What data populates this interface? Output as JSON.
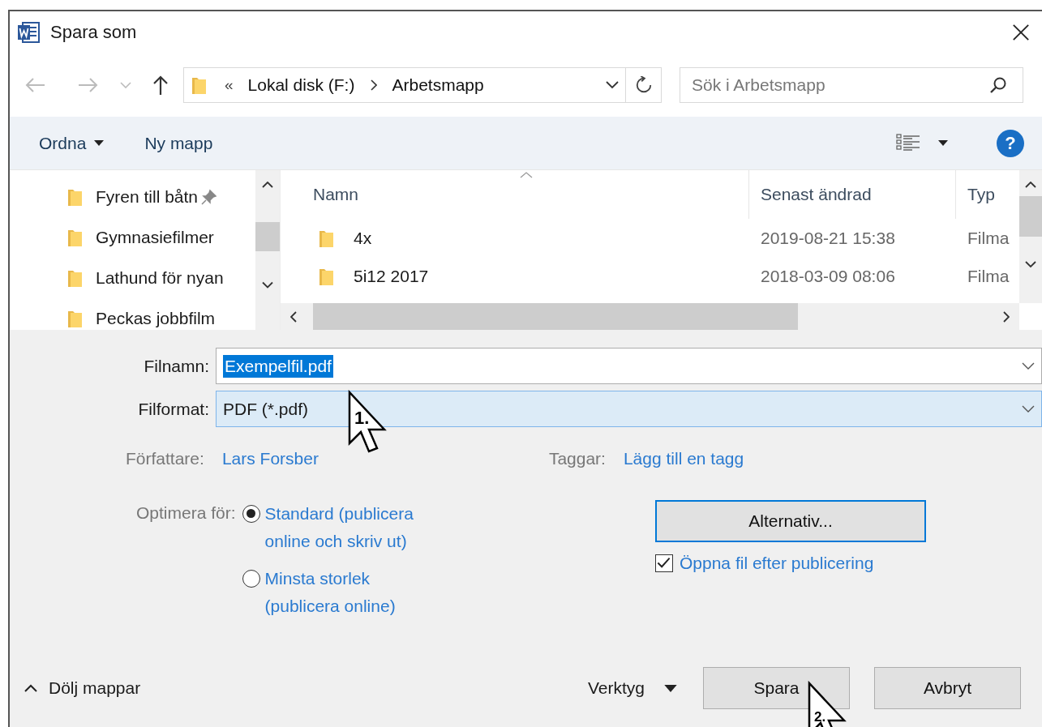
{
  "window": {
    "title": "Spara som"
  },
  "address": {
    "overflow_mark": "«",
    "path": [
      "Lokal disk (F:)",
      "Arbetsmapp"
    ]
  },
  "search": {
    "placeholder": "Sök i Arbetsmapp"
  },
  "toolbar": {
    "organize": "Ordna",
    "new_folder": "Ny mapp",
    "help": "?"
  },
  "sidebar": {
    "items": [
      {
        "label": "Fyren till båtn",
        "pinned": true
      },
      {
        "label": "Gymnasiefilmer",
        "pinned": false
      },
      {
        "label": "Lathund för nyan",
        "pinned": false
      },
      {
        "label": "Peckas jobbfilm",
        "pinned": false
      }
    ]
  },
  "table": {
    "columns": [
      "Namn",
      "Senast ändrad",
      "Typ"
    ],
    "rows": [
      {
        "name": "4x",
        "modified": "2019-08-21 15:38",
        "type": "Filma"
      },
      {
        "name": "5i12 2017",
        "modified": "2018-03-09 08:06",
        "type": "Filma"
      }
    ]
  },
  "form": {
    "filename": {
      "label": "Filnamn:",
      "value": "Exempelfil.pdf",
      "text_selected": true
    },
    "format": {
      "label": "Filformat:",
      "value": "PDF (*.pdf)",
      "focused": true
    },
    "author": {
      "label": "Författare:",
      "value": "Lars Forsber"
    },
    "tags": {
      "label": "Taggar:",
      "value": "Lägg till en tagg"
    }
  },
  "optimize": {
    "label": "Optimera för:",
    "options": [
      {
        "label": "Standard (publicera online och skriv ut)",
        "selected": true
      },
      {
        "label": "Minsta storlek (publicera online)",
        "selected": false
      }
    ]
  },
  "options_button": "Alternativ...",
  "open_after": {
    "label": "Öppna fil efter publicering",
    "checked": true
  },
  "footer": {
    "hide_folders": "Dölj mappar",
    "tools": "Verktyg",
    "buttons": [
      "Spara",
      "Avbryt"
    ]
  },
  "annotations": [
    {
      "label": "1."
    },
    {
      "label": "2."
    }
  ]
}
